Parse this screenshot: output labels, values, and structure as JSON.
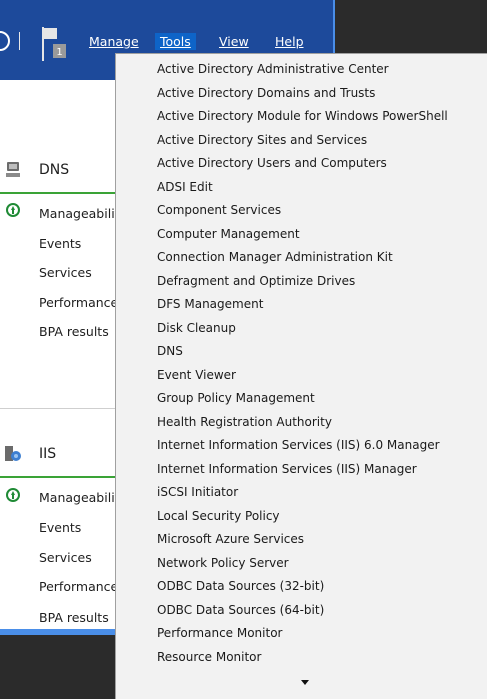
{
  "menubar": {
    "notifications_count": "1",
    "items": [
      "Manage",
      "Tools",
      "View",
      "Help"
    ],
    "active": "Tools"
  },
  "tiles": [
    {
      "title": "DNS",
      "rows": [
        "Manageability",
        "Events",
        "Services",
        "Performance",
        "BPA results"
      ]
    },
    {
      "title": "IIS",
      "rows": [
        "Manageability",
        "Events",
        "Services",
        "Performance",
        "BPA results"
      ]
    }
  ],
  "tools_menu": {
    "items": [
      "Active Directory Administrative Center",
      "Active Directory Domains and Trusts",
      "Active Directory Module for Windows PowerShell",
      "Active Directory Sites and Services",
      "Active Directory Users and Computers",
      "ADSI Edit",
      "Component Services",
      "Computer Management",
      "Connection Manager Administration Kit",
      "Defragment and Optimize Drives",
      "DFS Management",
      "Disk Cleanup",
      "DNS",
      "Event Viewer",
      "Group Policy Management",
      "Health Registration Authority",
      "Internet Information Services (IIS) 6.0 Manager",
      "Internet Information Services (IIS) Manager",
      "iSCSI Initiator",
      "Local Security Policy",
      "Microsoft Azure Services",
      "Network Policy Server",
      "ODBC Data Sources (32-bit)",
      "ODBC Data Sources (64-bit)",
      "Performance Monitor",
      "Resource Monitor"
    ]
  },
  "colors": {
    "titlebar": "#1d4a9b",
    "accent_border": "#4a8ee8",
    "menu_highlight": "#0e64c8",
    "status_ok": "#3aa336"
  }
}
